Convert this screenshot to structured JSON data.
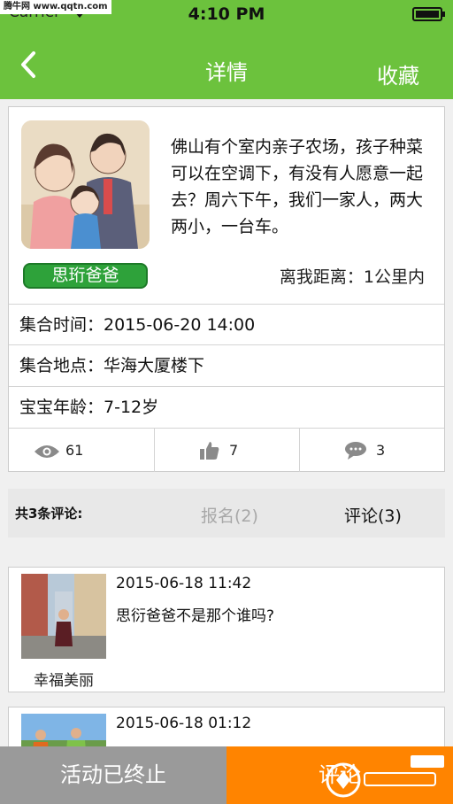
{
  "status": {
    "carrier": "Carrier",
    "time": "4:10 PM",
    "watermark": "腾牛网 www.qqtn.com"
  },
  "nav": {
    "title": "详情",
    "favorite": "收藏"
  },
  "activity": {
    "description": "佛山有个室内亲子农场，孩子种菜可以在空调下，有没有人愿意一起去？周六下午，我们一家人，两大两小，一台车。",
    "user": "思珩爸爸",
    "distance": "离我距离：1公里内",
    "meet_time": "集合时间：2015-06-20 14:00",
    "meet_place": "集合地点：华海大厦楼下",
    "baby_age": "宝宝年龄：7-12岁",
    "views": "61",
    "likes": "7",
    "comments": "3"
  },
  "comment_bar": {
    "count_label": "共3条评论:",
    "signup_tab": "报名(2)",
    "comments_tab": "评论(3)"
  },
  "comments": [
    {
      "name": "幸福美丽",
      "time": "2015-06-18 11:42",
      "text": "思衍爸爸不是那个谁吗?"
    },
    {
      "name": "",
      "time": "2015-06-18 01:12",
      "text": ""
    }
  ],
  "bottom": {
    "ended": "活动已终止",
    "comment": "评论"
  },
  "colors": {
    "primary_green": "#6cc23d",
    "badge_green": "#2ea23a",
    "orange": "#ff8400",
    "disabled_gray": "#9a9a9a"
  }
}
